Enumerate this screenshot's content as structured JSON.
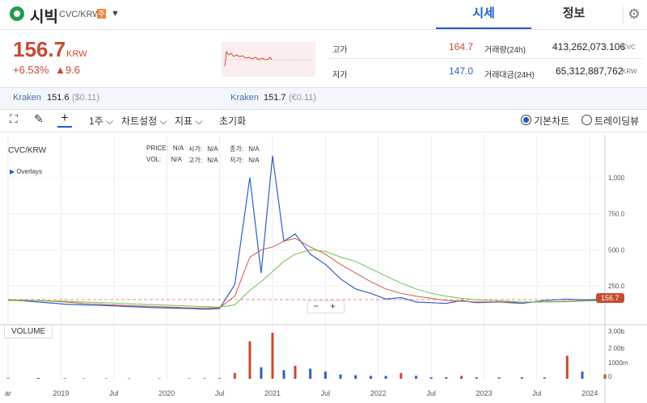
{
  "header": {
    "coin_name": "시빅",
    "pair": "CVC/KRW",
    "warning_badge": "주",
    "tabs": [
      "시세",
      "정보"
    ]
  },
  "price": {
    "current": "156.7",
    "unit": "KRW",
    "change_pct": "+6.53%",
    "change_abs": "▲9.6"
  },
  "stats": {
    "high_label": "고가",
    "high": "164.7",
    "low_label": "저가",
    "low": "147.0",
    "vol_label": "거래량(24h)",
    "vol": "413,262,073.106",
    "vol_unit": "CVC",
    "amt_label": "거래대금(24H)",
    "amt": "65,312,887,762",
    "amt_unit": "KRW"
  },
  "exchanges": [
    {
      "name": "Kraken",
      "price": "151.6",
      "note": "($0.11)"
    },
    {
      "name": "Kraken",
      "price": "151.7",
      "note": "(€0.11)"
    }
  ],
  "toolbar": {
    "interval": "1주",
    "chart_settings": "차트설정",
    "indicators": "지표",
    "reset": "초기화",
    "basic_chart": "기본차트",
    "trading_view": "트레이딩뷰"
  },
  "legend": {
    "symbol": "CVC/KRW",
    "overlays": "Overlays",
    "price_label": "PRICE:",
    "price_val": "N/A",
    "open_label": "시가:",
    "open_val": "N/A",
    "close_label": "종가:",
    "close_val": "N/A",
    "vol_label": "VOL:",
    "vol_val": "N/A",
    "high_label": "고가:",
    "high_val": "N/A",
    "low_label": "저가:",
    "low_val": "N/A",
    "volume_pane": "VOLUME",
    "last_price_tag": "156.7"
  },
  "colors": {
    "up": "#c84a31",
    "down": "#2f5fc4",
    "ma_fast": "#d0574f",
    "ma_slow": "#6cc24a"
  },
  "chart_data": {
    "type": "line",
    "x_ticks": [
      "ar",
      "2019",
      "Jul",
      "2020",
      "Jul",
      "2021",
      "Jul",
      "2022",
      "Jul",
      "2023",
      "Jul",
      "2024"
    ],
    "y_ticks": [
      "1,000",
      "750.0",
      "500.0",
      "250.0"
    ],
    "volume_ticks": [
      "3.00b",
      "2.00b",
      "1000m",
      "0"
    ],
    "ylim": [
      0,
      1250
    ],
    "x": [
      0,
      8,
      15,
      20,
      26,
      32,
      40,
      48,
      52,
      56,
      60,
      64,
      67,
      70,
      73,
      76,
      80,
      84,
      88,
      92,
      96,
      100,
      104,
      108,
      112,
      116,
      120,
      124,
      130,
      136,
      142,
      148,
      152,
      158
    ],
    "series": [
      {
        "values": [
          155,
          140,
          125,
          120,
          115,
          108,
          100,
          95,
          90,
          95,
          260,
          1000,
          340,
          1150,
          560,
          610,
          470,
          400,
          300,
          230,
          200,
          160,
          170,
          140,
          135,
          130,
          150,
          135,
          140,
          130,
          150,
          160,
          155,
          157
        ]
      },
      {
        "values": [
          155,
          150,
          140,
          130,
          122,
          115,
          108,
          100,
          98,
          100,
          180,
          450,
          500,
          520,
          560,
          580,
          520,
          470,
          400,
          340,
          280,
          230,
          200,
          180,
          165,
          150,
          145,
          140,
          140,
          138,
          140,
          145,
          150,
          152
        ]
      },
      {
        "values": [
          150,
          150,
          145,
          140,
          135,
          128,
          120,
          112,
          108,
          105,
          120,
          220,
          280,
          350,
          420,
          470,
          500,
          490,
          450,
          420,
          370,
          320,
          270,
          230,
          200,
          180,
          165,
          155,
          148,
          140,
          140,
          142,
          146,
          150
        ]
      }
    ],
    "volume": [
      0.05,
      0.06,
      0.04,
      0.03,
      0.03,
      0.02,
      0.02,
      0.03,
      0.04,
      0.05,
      0.4,
      2.6,
      0.8,
      3.2,
      0.6,
      0.9,
      0.7,
      0.5,
      0.3,
      0.25,
      0.2,
      0.2,
      0.4,
      0.2,
      0.1,
      0.1,
      0.2,
      0.1,
      0.1,
      0.1,
      0.1,
      1.6,
      0.5,
      0.3
    ]
  }
}
